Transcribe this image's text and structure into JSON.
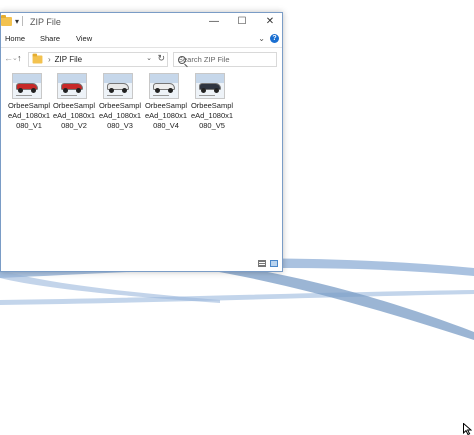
{
  "colors": {
    "accent": "#1a6fd1",
    "folder": "#f3c24f",
    "wallpaper_band": "#7a9cc6"
  },
  "titlebar": {
    "title": "ZIP File",
    "quick_access": "▾",
    "minimize": "—",
    "maximize": "☐",
    "close": "✕"
  },
  "ribbon": {
    "tabs": [
      "Home",
      "Share",
      "View"
    ],
    "expand": "⌄",
    "help": "?"
  },
  "navigation": {
    "back": "←",
    "forward": "→",
    "recent": "⌄",
    "up": "↑",
    "breadcrumb_separator": "›",
    "location": "ZIP File",
    "address_dropdown": "⌄",
    "refresh": "↻",
    "search_placeholder": "Search ZIP File"
  },
  "files": [
    {
      "name": "OrbeeSampleAd_1080x1080_V1",
      "car_color": "#c62828"
    },
    {
      "name": "OrbeeSampleAd_1080x1080_V2",
      "car_color": "#c62828"
    },
    {
      "name": "OrbeeSampleAd_1080x1080_V3",
      "car_color": "#e8e8e8"
    },
    {
      "name": "OrbeeSampleAd_1080x1080_V4",
      "car_color": "#eeeeee"
    },
    {
      "name": "OrbeeSampleAd_1080x1080_V5",
      "car_color": "#2e3440"
    }
  ],
  "status": {
    "view_details": "details-view-icon",
    "view_large": "large-icons-view-icon"
  }
}
